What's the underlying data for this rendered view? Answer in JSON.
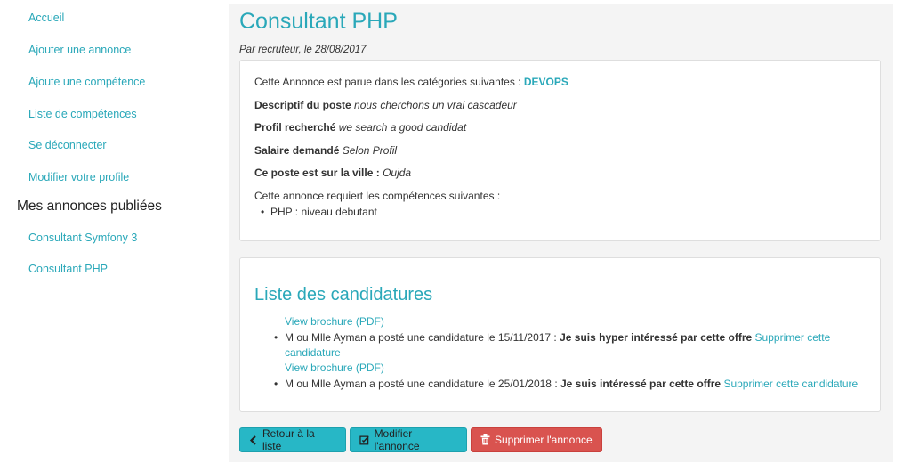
{
  "sidebar": {
    "items": [
      {
        "label": "Accueil"
      },
      {
        "label": "Ajouter une annonce"
      },
      {
        "label": "Ajoute une compétence"
      },
      {
        "label": "Liste de compétences"
      },
      {
        "label": "Se déconnecter"
      },
      {
        "label": "Modifier votre profile"
      }
    ],
    "heading": "Mes annonces publiées",
    "annonces": [
      {
        "label": "Consultant Symfony 3"
      },
      {
        "label": "Consultant PHP"
      }
    ]
  },
  "main": {
    "title": "Consultant PHP",
    "byline": "Par recruteur, le 28/08/2017",
    "details": {
      "categories_prefix": "Cette Annonce est parue dans les catégories suivantes :",
      "category": "DEVOPS",
      "descriptif_label": "Descriptif du poste",
      "descriptif_value": "nous cherchons un vrai cascadeur",
      "profil_label": "Profil recherché",
      "profil_value": "we search a good candidat",
      "salaire_label": "Salaire demandé",
      "salaire_value": "Selon Profil",
      "ville_label": "Ce poste est sur la ville :",
      "ville_value": "Oujda",
      "competences_intro": "Cette annonce requiert les compétences suivantes :",
      "competences": [
        "PHP : niveau debutant"
      ]
    },
    "candidatures": {
      "title": "Liste des candidatures",
      "items": [
        {
          "brochure": "View brochure (PDF)",
          "text": "M ou Mlle Ayman a posté une candidature le 15/11/2017 :",
          "message": "Je suis hyper intéressé par cette offre",
          "delete_line1": "Supprimer cette",
          "delete_line2": "candidature"
        },
        {
          "brochure": "View brochure (PDF)",
          "text": "M ou Mlle Ayman a posté une candidature le 25/01/2018 :",
          "message": "Je suis intéressé par cette offre",
          "delete": "Supprimer cette candidature"
        }
      ]
    },
    "buttons": {
      "back": "Retour à la liste",
      "edit": "Modifier l'annonce",
      "delete": "Supprimer l'annonce"
    }
  },
  "colors": {
    "accent": "#2aa8b9",
    "button_primary": "#27b7c6",
    "button_danger": "#d9534f"
  },
  "icons": {
    "back": "chevron-left-icon",
    "edit": "edit-icon",
    "delete": "trash-icon"
  }
}
